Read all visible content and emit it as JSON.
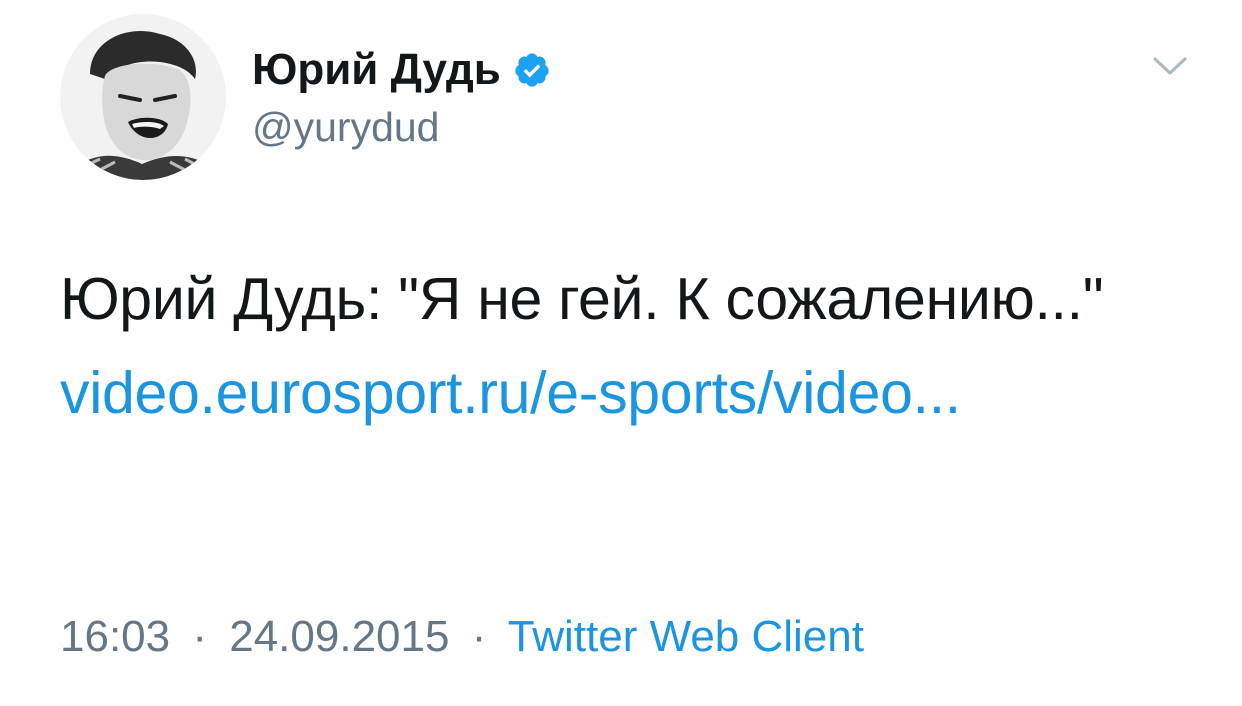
{
  "author": {
    "display_name": "Юрий Дудь",
    "handle": "@yurydud",
    "verified": true
  },
  "tweet": {
    "text_before_link": "Юрий Дудь: \"Я не гей. К сожалению...\"",
    "link_text": "video.eurosport.ru/e-sports/video..."
  },
  "meta": {
    "time": "16:03",
    "separator": "·",
    "date": "24.09.2015",
    "source": "Twitter Web Client"
  },
  "icons": {
    "verified": "verified-badge-icon",
    "menu": "chevron-down-icon"
  },
  "colors": {
    "link": "#1b95e0",
    "verified": "#1da1f2",
    "secondary_text": "#657786",
    "primary_text": "#14171a"
  }
}
